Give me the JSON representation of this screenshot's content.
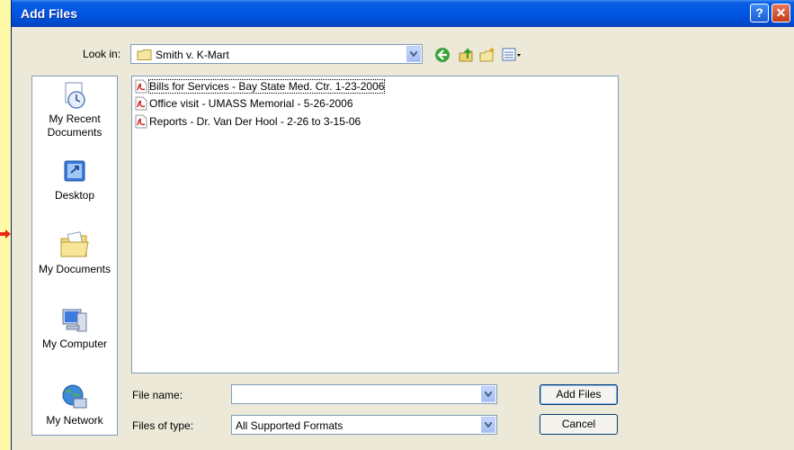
{
  "window": {
    "title": "Add Files"
  },
  "titlebar": {
    "help_glyph": "?",
    "close_glyph": "✕"
  },
  "lookin": {
    "label": "Look in:",
    "value": "Smith v. K-Mart"
  },
  "toolbar": {
    "icons": [
      "back-icon",
      "up-folder-icon",
      "new-folder-icon",
      "views-menu-icon"
    ]
  },
  "places": [
    {
      "label_lines": [
        "My Recent",
        "Documents"
      ],
      "icon": "recent-documents-icon"
    },
    {
      "label_lines": [
        "Desktop"
      ],
      "icon": "desktop-icon"
    },
    {
      "label_lines": [
        "My Documents"
      ],
      "icon": "my-documents-icon"
    },
    {
      "label_lines": [
        "My Computer"
      ],
      "icon": "my-computer-icon"
    },
    {
      "label_lines": [
        "My Network"
      ],
      "icon": "my-network-icon"
    }
  ],
  "files": [
    {
      "name": "Bills for Services - Bay State Med. Ctr. 1-23-2006",
      "icon": "pdf-icon"
    },
    {
      "name": "Office visit - UMASS Memorial - 5-26-2006",
      "icon": "pdf-icon"
    },
    {
      "name": "Reports - Dr. Van Der Hool - 2-26 to 3-15-06",
      "icon": "pdf-icon"
    }
  ],
  "filename": {
    "label": "File name:",
    "value": ""
  },
  "filetype": {
    "label": "Files of type:",
    "value": "All Supported Formats"
  },
  "buttons": {
    "add": "Add Files",
    "cancel": "Cancel"
  },
  "colors": {
    "titlebar": "#0054e3",
    "dialog_bg": "#ece9d8",
    "page_bg": "#fdf9a6",
    "pointer_arrow": "#e8251b"
  }
}
